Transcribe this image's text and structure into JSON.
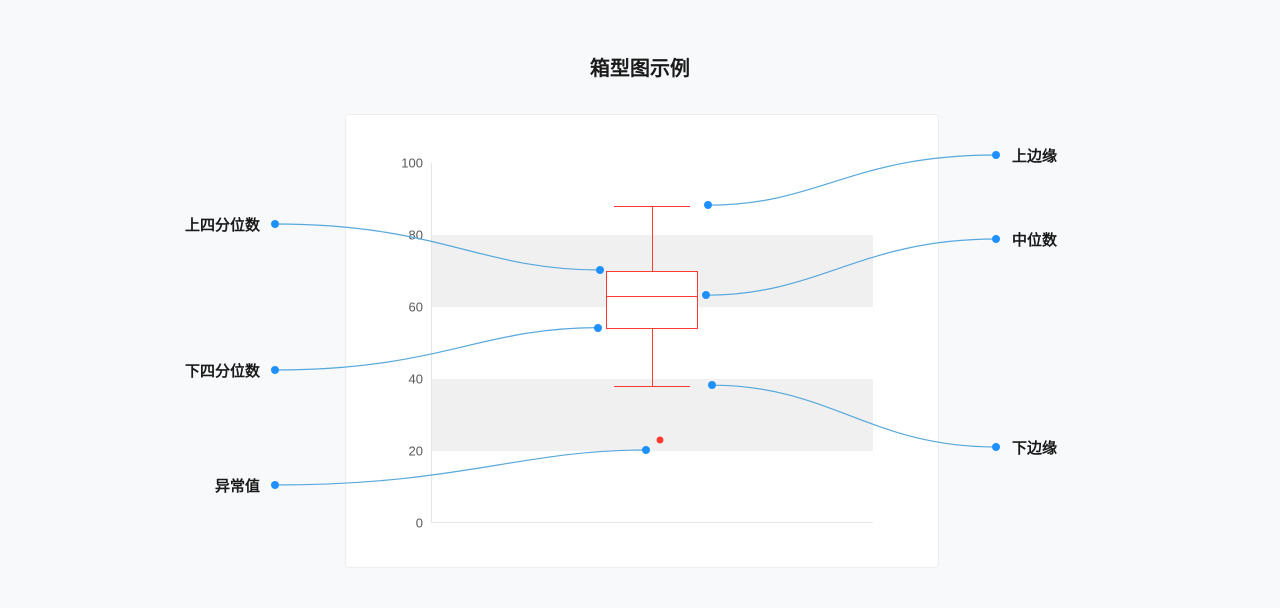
{
  "title": "箱型图示例",
  "labels": {
    "upper_whisker": "上边缘",
    "median": "中位数",
    "lower_whisker": "下边缘",
    "upper_quartile": "上四分位数",
    "lower_quartile": "下四分位数",
    "outlier": "异常值"
  },
  "ticks": [
    "0",
    "20",
    "40",
    "60",
    "80",
    "100"
  ],
  "chart_data": {
    "type": "boxplot",
    "title": "箱型图示例",
    "ylabel": "",
    "ylim": [
      0,
      100
    ],
    "categories": [
      ""
    ],
    "series": [
      {
        "name": "",
        "min": 38,
        "q1": 54,
        "median": 63,
        "q3": 70,
        "max": 88,
        "outliers": [
          23
        ]
      }
    ],
    "annotations": [
      {
        "target": "max",
        "text": "上边缘"
      },
      {
        "target": "q3",
        "text": "上四分位数"
      },
      {
        "target": "median",
        "text": "中位数"
      },
      {
        "target": "q1",
        "text": "下四分位数"
      },
      {
        "target": "min",
        "text": "下边缘"
      },
      {
        "target": "outlier",
        "text": "异常值"
      }
    ]
  }
}
